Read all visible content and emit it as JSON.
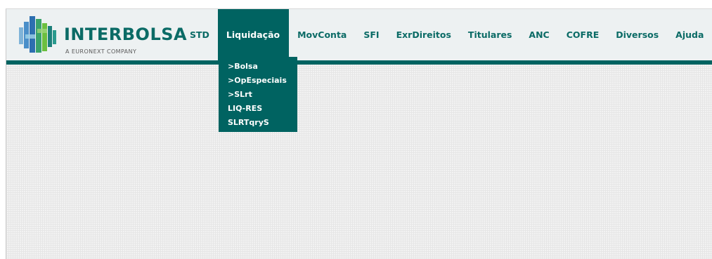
{
  "brand": {
    "name": "INTERBOLSA",
    "tagline": "A EURONEXT COMPANY",
    "logo_icon": "interbolsa-logo-icon",
    "colors": {
      "primary": "#006361",
      "text": "#0b6b66",
      "header_bg": "#edf1f2"
    }
  },
  "nav": {
    "items": [
      {
        "label": "STD"
      },
      {
        "label": "Liquidação"
      },
      {
        "label": "MovConta"
      },
      {
        "label": "SFI"
      },
      {
        "label": "ExrDireitos"
      },
      {
        "label": "Titulares"
      },
      {
        "label": "ANC"
      },
      {
        "label": "COFRE"
      },
      {
        "label": "Diversos"
      },
      {
        "label": "Ajuda"
      }
    ],
    "active": "Liquidação"
  },
  "dropdown": {
    "items": [
      {
        "label": ">Bolsa"
      },
      {
        "label": ">OpEspeciais"
      },
      {
        "label": ">SLrt"
      },
      {
        "label": "LIQ-RES"
      },
      {
        "label": "SLRTqryS"
      }
    ]
  }
}
